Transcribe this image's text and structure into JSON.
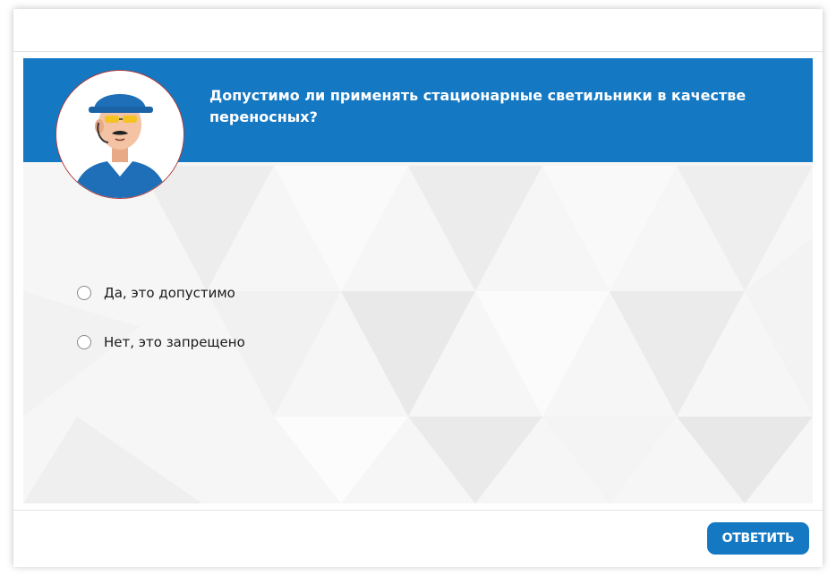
{
  "question": {
    "text": "Допустимо ли применять стационарные светильники в качестве переносных?"
  },
  "avatar": {
    "icon": "worker-avatar-icon",
    "description_colors": {
      "helmet": "#1e6fb8",
      "skin": "#f3c3a4",
      "shirt": "#1e6fb8"
    }
  },
  "options": [
    {
      "label": "Да, это допустимо",
      "selected": false
    },
    {
      "label": "Нет, это запрещено",
      "selected": false
    }
  ],
  "footer": {
    "submit_label": "ОТВЕТИТЬ"
  },
  "colors": {
    "accent": "#1478c3",
    "background": "#f7f7f7",
    "text": "#1a1a1a"
  }
}
